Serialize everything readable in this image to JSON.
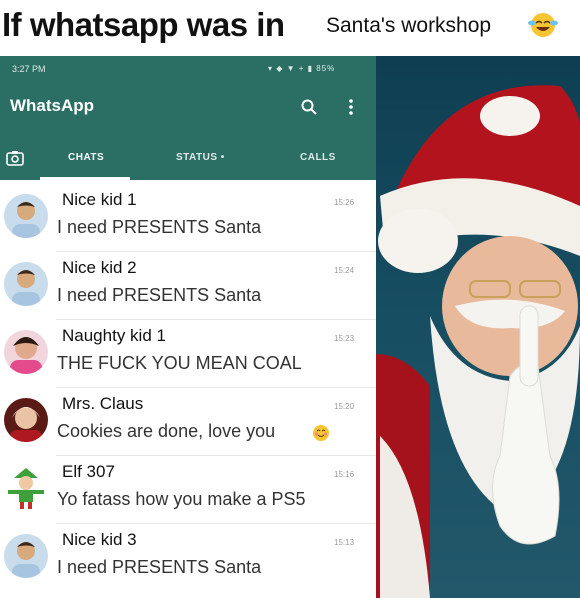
{
  "caption": {
    "line_big": "If whatsapp was in",
    "line_small": "Santa's workshop"
  },
  "app": {
    "status_time": "3:27 PM",
    "status_icons": "▾ ◆ ▼ + ▮ 85%",
    "title": "WhatsApp",
    "tabs": {
      "chats": "CHATS",
      "status": "STATUS •",
      "calls": "CALLS"
    },
    "colors": {
      "header": "#2b6e63",
      "accent": "#ffffff"
    }
  },
  "chats": [
    {
      "name": "Nice kid 1",
      "message": "I need PRESENTS Santa",
      "time": "15:26",
      "avatar": "boy-avatar"
    },
    {
      "name": "Nice kid 2",
      "message": "I need PRESENTS Santa",
      "time": "15:24",
      "avatar": "boy-avatar"
    },
    {
      "name": "Naughty kid 1",
      "message": "THE FUCK YOU MEAN COAL",
      "time": "15:23",
      "avatar": "angry-girl-avatar"
    },
    {
      "name": "Mrs. Claus",
      "message": "Cookies are done, love you",
      "time": "15:20",
      "avatar": "mrs-claus-avatar"
    },
    {
      "name": "Elf 307",
      "message": "Yo fatass how you make a PS5",
      "time": "15:16",
      "avatar": "elf-avatar"
    },
    {
      "name": "Nice kid 3",
      "message": "I need PRESENTS Santa",
      "time": "15:13",
      "avatar": "boy-avatar"
    }
  ]
}
